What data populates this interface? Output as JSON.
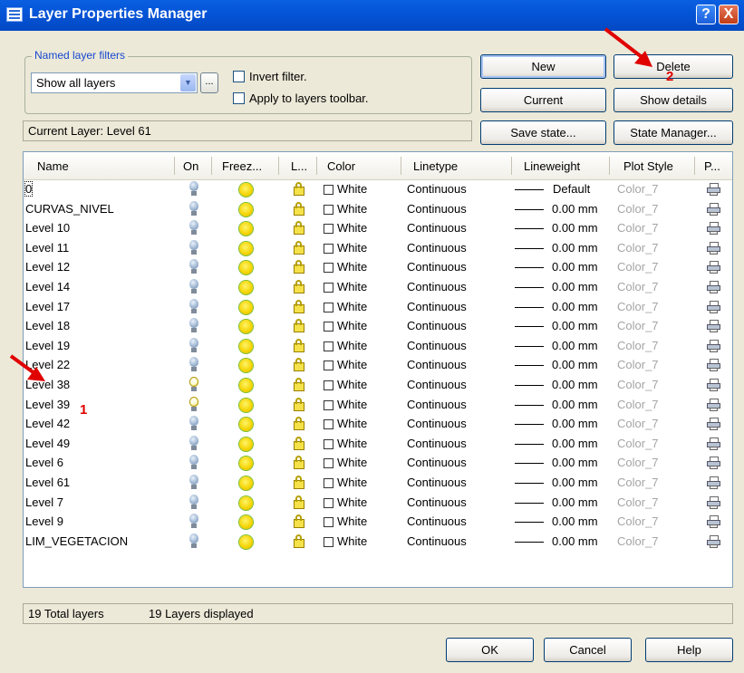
{
  "window": {
    "title": "Layer Properties Manager",
    "help": "?",
    "close": "X"
  },
  "filters": {
    "legend": "Named layer filters",
    "selected": "Show all layers",
    "ellipsis": "...",
    "invert_label": "Invert filter.",
    "apply_label": "Apply to layers toolbar."
  },
  "buttons": {
    "new": "New",
    "delete": "Delete",
    "current": "Current",
    "show_details": "Show details",
    "save_state": "Save state...",
    "state_manager": "State Manager...",
    "ok": "OK",
    "cancel": "Cancel",
    "help": "Help"
  },
  "current_layer": "Current Layer:  Level 61",
  "columns": [
    "Name",
    "On",
    "Freez...",
    "L...",
    "Color",
    "Linetype",
    "Lineweight",
    "Plot Style",
    "P..."
  ],
  "layers": [
    {
      "name": "0",
      "on": true,
      "color": "White",
      "linetype": "Continuous",
      "lineweight": "Default",
      "plot_style": "Color_7"
    },
    {
      "name": "CURVAS_NIVEL",
      "on": true,
      "color": "White",
      "linetype": "Continuous",
      "lineweight": "0.00 mm",
      "plot_style": "Color_7"
    },
    {
      "name": "Level 10",
      "on": true,
      "color": "White",
      "linetype": "Continuous",
      "lineweight": "0.00 mm",
      "plot_style": "Color_7"
    },
    {
      "name": "Level 11",
      "on": true,
      "color": "White",
      "linetype": "Continuous",
      "lineweight": "0.00 mm",
      "plot_style": "Color_7"
    },
    {
      "name": "Level 12",
      "on": true,
      "color": "White",
      "linetype": "Continuous",
      "lineweight": "0.00 mm",
      "plot_style": "Color_7"
    },
    {
      "name": "Level 14",
      "on": true,
      "color": "White",
      "linetype": "Continuous",
      "lineweight": "0.00 mm",
      "plot_style": "Color_7"
    },
    {
      "name": "Level 17",
      "on": true,
      "color": "White",
      "linetype": "Continuous",
      "lineweight": "0.00 mm",
      "plot_style": "Color_7"
    },
    {
      "name": "Level 18",
      "on": true,
      "color": "White",
      "linetype": "Continuous",
      "lineweight": "0.00 mm",
      "plot_style": "Color_7"
    },
    {
      "name": "Level 19",
      "on": true,
      "color": "White",
      "linetype": "Continuous",
      "lineweight": "0.00 mm",
      "plot_style": "Color_7"
    },
    {
      "name": "Level 22",
      "on": true,
      "color": "White",
      "linetype": "Continuous",
      "lineweight": "0.00 mm",
      "plot_style": "Color_7"
    },
    {
      "name": "Level 38",
      "on": false,
      "color": "White",
      "linetype": "Continuous",
      "lineweight": "0.00 mm",
      "plot_style": "Color_7"
    },
    {
      "name": "Level 39",
      "on": false,
      "color": "White",
      "linetype": "Continuous",
      "lineweight": "0.00 mm",
      "plot_style": "Color_7"
    },
    {
      "name": "Level 42",
      "on": true,
      "color": "White",
      "linetype": "Continuous",
      "lineweight": "0.00 mm",
      "plot_style": "Color_7"
    },
    {
      "name": "Level 49",
      "on": true,
      "color": "White",
      "linetype": "Continuous",
      "lineweight": "0.00 mm",
      "plot_style": "Color_7"
    },
    {
      "name": "Level 6",
      "on": true,
      "color": "White",
      "linetype": "Continuous",
      "lineweight": "0.00 mm",
      "plot_style": "Color_7"
    },
    {
      "name": "Level 61",
      "on": true,
      "color": "White",
      "linetype": "Continuous",
      "lineweight": "0.00 mm",
      "plot_style": "Color_7"
    },
    {
      "name": "Level 7",
      "on": true,
      "color": "White",
      "linetype": "Continuous",
      "lineweight": "0.00 mm",
      "plot_style": "Color_7"
    },
    {
      "name": "Level 9",
      "on": true,
      "color": "White",
      "linetype": "Continuous",
      "lineweight": "0.00 mm",
      "plot_style": "Color_7"
    },
    {
      "name": "LIM_VEGETACION",
      "on": true,
      "color": "White",
      "linetype": "Continuous",
      "lineweight": "0.00 mm",
      "plot_style": "Color_7"
    }
  ],
  "status": {
    "total": "19 Total layers",
    "displayed": "19 Layers displayed"
  },
  "annotations": {
    "marker_1": "1",
    "marker_2": "2",
    "color": "#e00000"
  },
  "colors": {
    "titlebar": "#0555d8",
    "dialog": "#ece9d8",
    "legend": "#1747cf",
    "plot_style_text": "#a4a4a4"
  }
}
